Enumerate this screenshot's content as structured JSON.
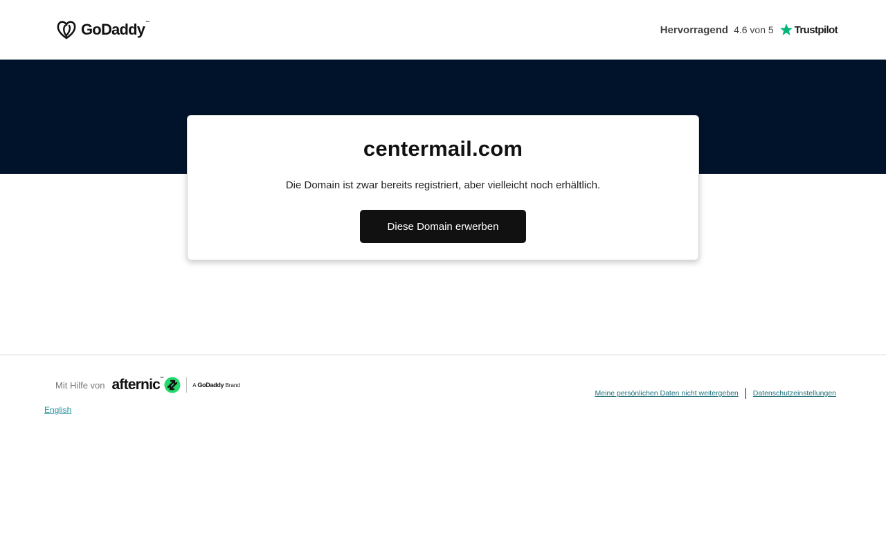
{
  "header": {
    "logo_text": "GoDaddy",
    "logo_tm": "™",
    "rating_label": "Hervorragend",
    "rating_score": "4.6 von 5",
    "trustpilot_name": "Trustpilot"
  },
  "card": {
    "domain": "centermail.com",
    "description": "Die Domain ist zwar bereits registriert, aber vielleicht noch erhältlich.",
    "buy_button_label": "Diese Domain erwerben"
  },
  "footer": {
    "powered_label": "Mit Hilfe von",
    "afternic_text": "afternic",
    "afternic_tm": "™",
    "brand_tag_prefix": "A",
    "brand_tag_name": "GoDaddy",
    "brand_tag_suffix": "Brand",
    "language_link": "English",
    "legal_links": [
      "Meine persönlichen Daten nicht weitergeben",
      "Datenschutzeinstellungen"
    ]
  },
  "colors": {
    "hero_bg": "#00132b",
    "button_bg": "#111111",
    "trustpilot_green": "#00b67a",
    "afternic_green": "#22d96a",
    "link_teal": "#1e8f9a"
  },
  "icons": {
    "logo": "godaddy-heart-icon",
    "trustpilot": "star-icon",
    "afternic": "afternic-arrows-icon"
  }
}
